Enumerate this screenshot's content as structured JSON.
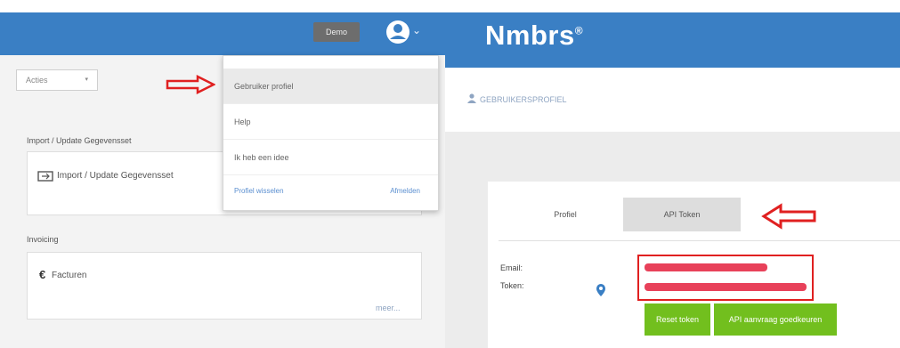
{
  "colors": {
    "brand_blue": "#3a7fc4",
    "green": "#72bf1e",
    "red": "#e02020"
  },
  "header": {
    "demo_label": "Demo",
    "user_icon": "user-circle-icon",
    "caret_icon": "chevron-down-icon"
  },
  "brand": {
    "name": "Nmbrs",
    "mark": "®"
  },
  "left": {
    "filter": {
      "value": "Acties",
      "caret": "▾"
    },
    "sections": [
      {
        "title": "Import / Update Gegevensset",
        "card_label": "Import / Update Gegevensset",
        "icon": "import-icon"
      },
      {
        "title": "Invoicing",
        "card_label": "Facturen",
        "icon": "euro-icon",
        "more": "meer..."
      }
    ]
  },
  "profile_menu": {
    "items": [
      {
        "label": "Gebruiker profiel"
      },
      {
        "label": "Help"
      },
      {
        "label": "Ik heb een idee"
      }
    ],
    "footer_left": "Profiel wisselen",
    "footer_right": "Afmelden"
  },
  "breadcrumb": {
    "icon": "user-icon",
    "label": "GEBRUIKERSPROFIEL"
  },
  "tabs": [
    {
      "label": "Profiel",
      "active": false
    },
    {
      "label": "API Token",
      "active": true
    }
  ],
  "fields": {
    "email_label": "Email:",
    "token_label": "Token:"
  },
  "buttons": {
    "reset": "Reset token",
    "api_request": "API aanvraag goedkeuren"
  }
}
